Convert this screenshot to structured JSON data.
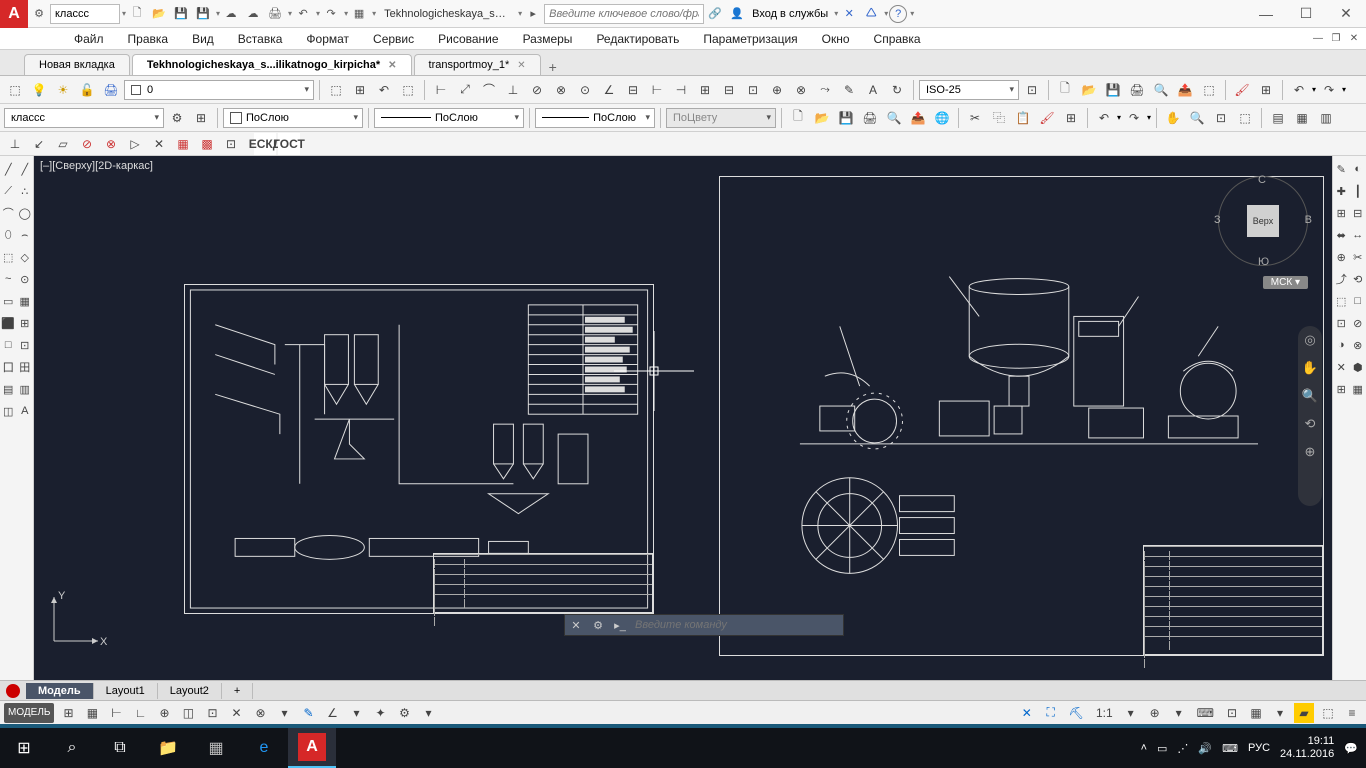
{
  "titlebar": {
    "qat_dropdown": "классс",
    "filename": "Tekhnologicheskaya_skhema_...",
    "search_placeholder": "Введите ключевое слово/фразу",
    "signin": "Вход в службы"
  },
  "menu": {
    "items": [
      "Файл",
      "Правка",
      "Вид",
      "Вставка",
      "Формат",
      "Сервис",
      "Рисование",
      "Размеры",
      "Редактировать",
      "Параметризация",
      "Окно",
      "Справка"
    ]
  },
  "filetabs": {
    "items": [
      {
        "label": "Новая вкладка",
        "active": false,
        "dirty": false
      },
      {
        "label": "Tekhnologicheskaya_s...ilikatnogo_kirpicha*",
        "active": true,
        "dirty": true
      },
      {
        "label": "transportmoy_1*",
        "active": false,
        "dirty": true
      }
    ]
  },
  "props": {
    "layer_combo": "0",
    "style_combo": "классс",
    "color": "ПоСлою",
    "linetype": "ПоСлою",
    "lineweight": "ПоСлою",
    "plotstyle": "ПоЦвету",
    "dimstyle": "ISO-25",
    "gost_buttons": [
      "ЕСКД",
      "ГОСТ"
    ]
  },
  "canvas": {
    "view_label": "[–][Сверху][2D-каркас]",
    "viewcube": {
      "top": "Верх",
      "n": "С",
      "s": "Ю",
      "e": "В",
      "w": "З"
    },
    "mck": "МСК",
    "ucs": {
      "x": "X",
      "y": "Y"
    }
  },
  "cmdline": {
    "placeholder": "Введите команду"
  },
  "layout_tabs": [
    "Модель",
    "Layout1",
    "Layout2"
  ],
  "statusbar": {
    "model": "МОДЕЛЬ",
    "scale": "1:1",
    "lang": "РУС"
  },
  "taskbar": {
    "time": "19:11",
    "date": "24.11.2016",
    "lang": "РУС"
  },
  "left_tools": [
    "╱",
    "╱",
    "⟋",
    "∴",
    "⌒",
    "◯",
    "⬯",
    "⌢",
    "⬚",
    "◇",
    "~",
    "⊙",
    "▭",
    "▦",
    "⬛",
    "⊞",
    "□",
    "⊡",
    "囗",
    "田",
    "▤",
    "▥",
    "◫",
    "A"
  ],
  "right_tools": [
    "✎",
    "◐",
    "✚",
    "┃",
    "⊞",
    "⊟",
    "⬌",
    "↔",
    "⊕",
    "✂",
    "⤴",
    "⟲",
    "⬚",
    "□",
    "⊡",
    "⊘",
    "◑",
    "⊗",
    "✕",
    "⬢",
    "⊞",
    "▦"
  ],
  "status_icons": [
    "⊞",
    "▦",
    "⊢",
    "∟",
    "⊕",
    "◫",
    "⊡",
    "✕",
    "⊗",
    "▾",
    "✎",
    "∠",
    "▾",
    "✦",
    "⚙",
    "▾"
  ],
  "status_icons_right": [
    "✕",
    "⛶",
    "⛏",
    "▾",
    "⊕",
    "▾",
    "⌨",
    "⊡",
    "▦",
    "▾",
    "⬚",
    "≡"
  ]
}
